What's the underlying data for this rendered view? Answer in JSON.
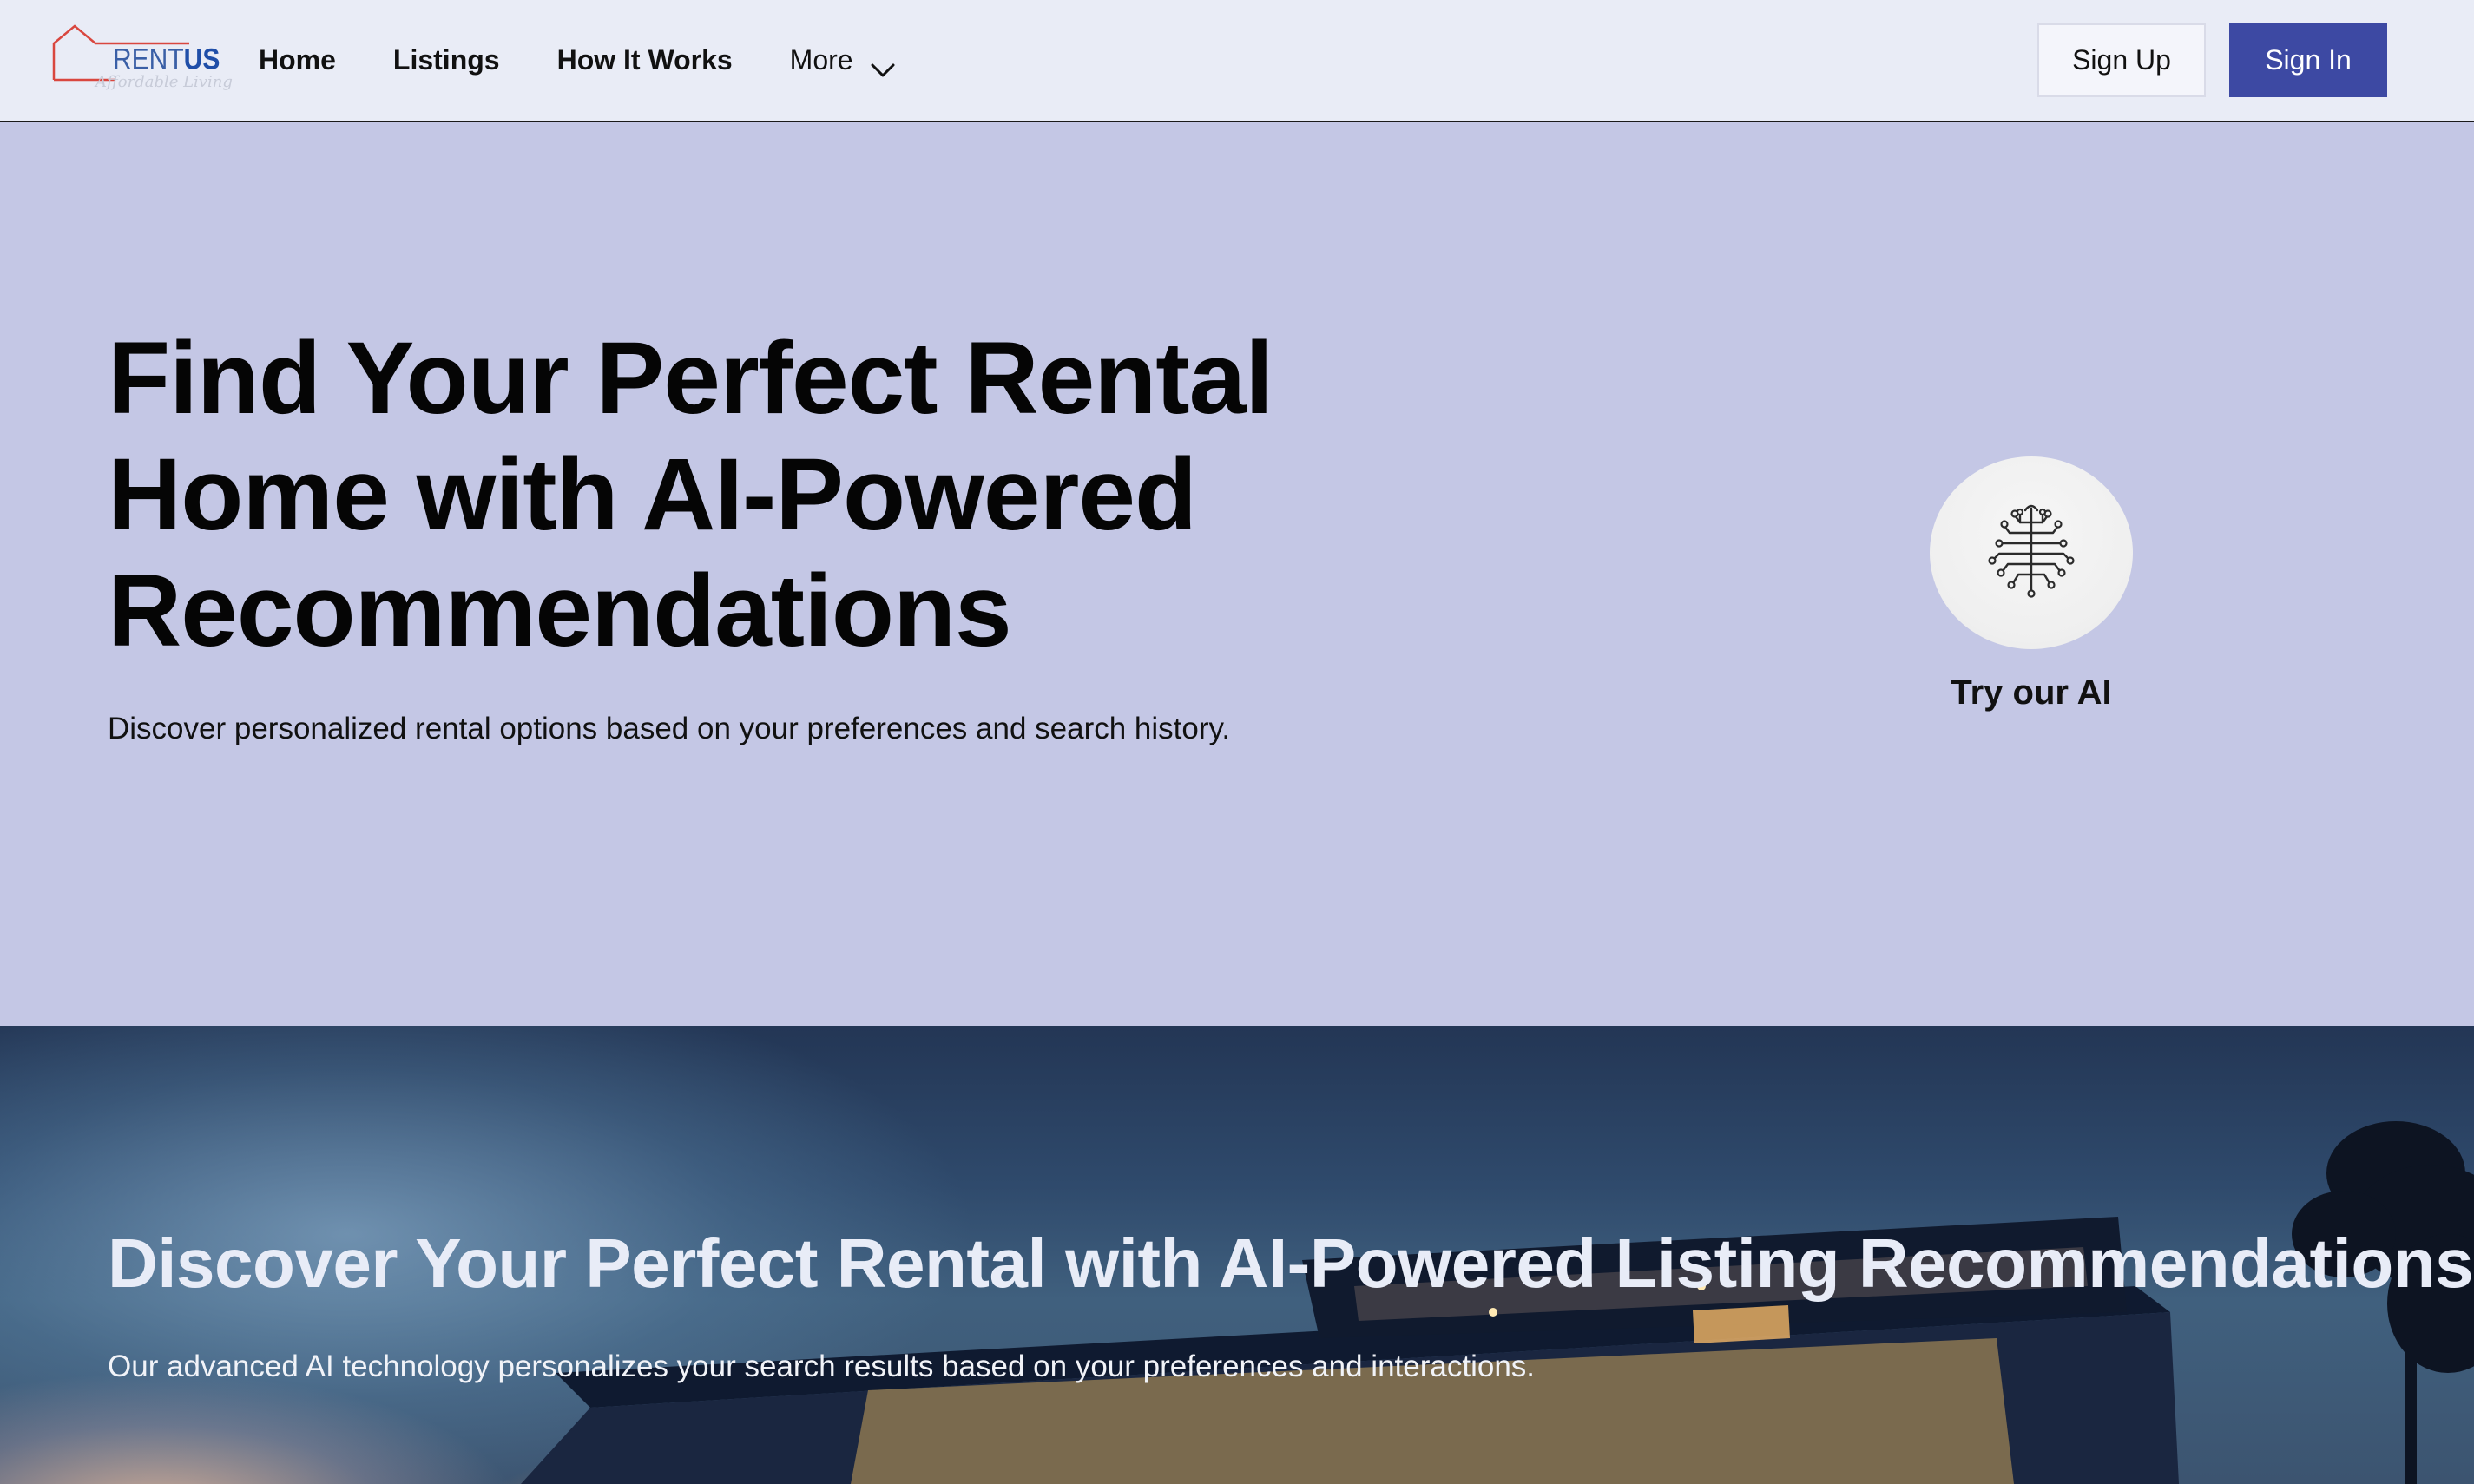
{
  "brand": {
    "name_part1": "RENT",
    "name_part2": "US",
    "tagline": "Affordable Living",
    "colors": {
      "outline": "#d9473f",
      "text": "#1f4ea8"
    }
  },
  "nav": {
    "links": [
      "Home",
      "Listings",
      "How It Works"
    ],
    "more_label": "More",
    "more_icon": "chevron-down-icon"
  },
  "auth": {
    "signup_label": "Sign Up",
    "signin_label": "Sign In",
    "signin_color": "#3d49a3"
  },
  "hero": {
    "title_lines": [
      "Find Your Perfect Rental",
      "Home with AI-Powered",
      "Recommendations"
    ],
    "subtitle": "Discover personalized rental options based on your preferences and search history.",
    "ai_icon": "brain-circuit-icon",
    "ai_label": "Try our AI",
    "background": "#c4c7e5"
  },
  "discover": {
    "title": "Discover Your Perfect Rental with AI-Powered Listing Recommendations",
    "subtitle": "Our advanced AI technology personalizes your search results based on your preferences and interactions.",
    "background_image": "modern-house-at-dusk"
  }
}
